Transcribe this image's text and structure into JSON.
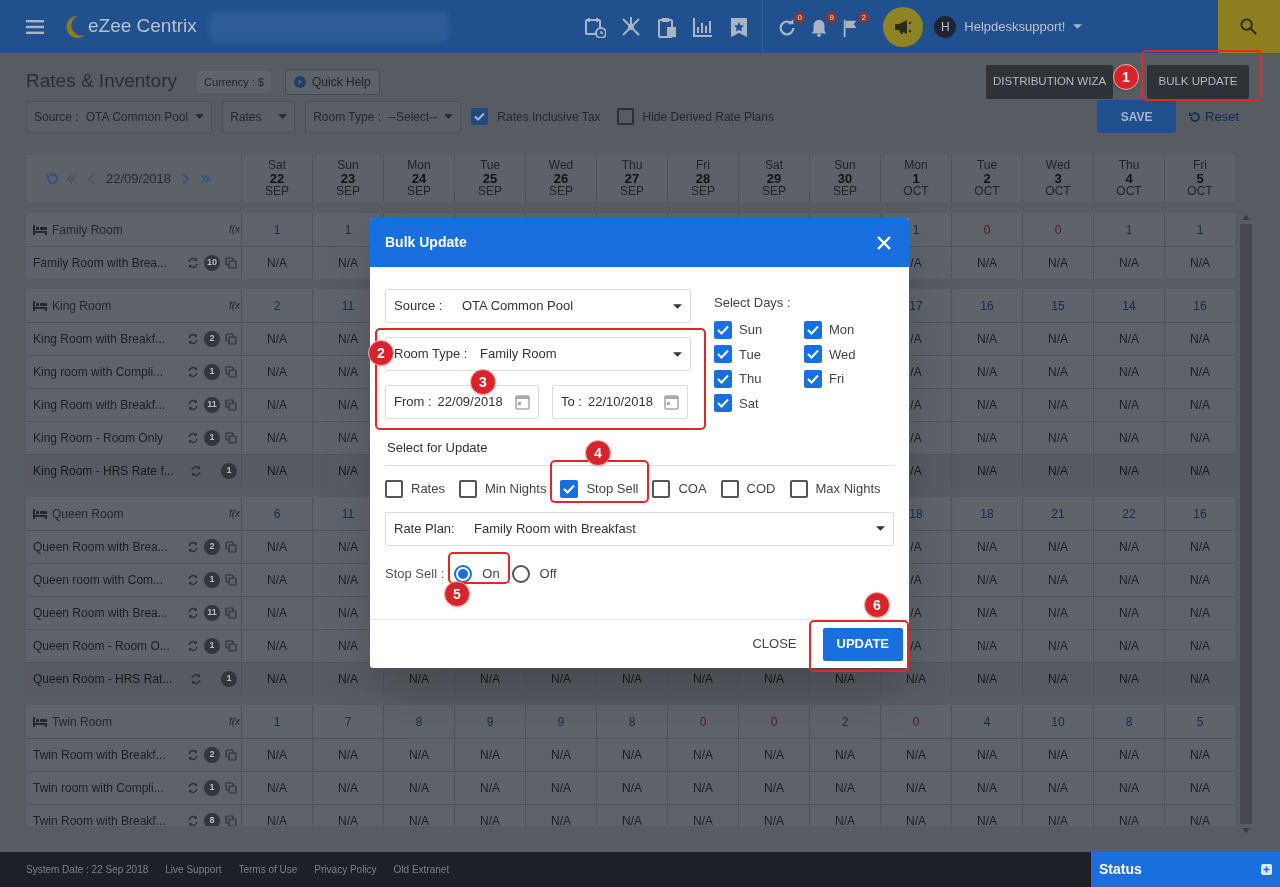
{
  "top_bar": {
    "app_name": "eZee Centrix",
    "notifications": [
      {
        "count": "0"
      },
      {
        "count": "9"
      },
      {
        "count": "2"
      }
    ],
    "user": {
      "initial": "H",
      "name": "Helpdesksupport!"
    }
  },
  "page": {
    "title": "Rates & Inventory",
    "currency": "Currency : $",
    "quick_help": "Quick Help",
    "buttons": [
      "DISTRIBUTION WIZA",
      "BULK UPDATE"
    ]
  },
  "filters": {
    "source": {
      "label": "Source :",
      "value": "OTA Common Pool"
    },
    "rates": {
      "value": "Rates"
    },
    "room_type": {
      "label": "Room Type :",
      "value": "--Select--"
    },
    "checkboxes": [
      {
        "label": "Rates Inclusive Tax",
        "checked": true
      },
      {
        "label": "Hide Derived Rate Plans",
        "checked": false
      }
    ],
    "save": "SAVE",
    "reset": "Reset"
  },
  "grid": {
    "date": "22/09/2018",
    "columns": [
      {
        "day": "Sat",
        "date": "22",
        "month": "SEP"
      },
      {
        "day": "Sun",
        "date": "23",
        "month": "SEP"
      },
      {
        "day": "Mon",
        "date": "24",
        "month": "SEP"
      },
      {
        "day": "Tue",
        "date": "25",
        "month": "SEP"
      },
      {
        "day": "Wed",
        "date": "26",
        "month": "SEP"
      },
      {
        "day": "Thu",
        "date": "27",
        "month": "SEP"
      },
      {
        "day": "Fri",
        "date": "28",
        "month": "SEP"
      },
      {
        "day": "Sat",
        "date": "29",
        "month": "SEP"
      },
      {
        "day": "Sun",
        "date": "30",
        "month": "SEP"
      },
      {
        "day": "Mon",
        "date": "1",
        "month": "OCT"
      },
      {
        "day": "Tue",
        "date": "2",
        "month": "OCT"
      },
      {
        "day": "Wed",
        "date": "3",
        "month": "OCT"
      },
      {
        "day": "Thu",
        "date": "4",
        "month": "OCT"
      },
      {
        "day": "Fri",
        "date": "5",
        "month": "OCT"
      }
    ],
    "groups": [
      {
        "name": "Family Room",
        "formula": "f(x",
        "availability": [
          {
            "value": "1",
            "color": "#142a4d"
          },
          {
            "value": "1",
            "color": "#142a4d"
          },
          {
            "value": "1",
            "color": "#142a4d"
          },
          {
            "value": "0",
            "color": "#5a1414"
          },
          {
            "value": "0",
            "color": "#5a1414"
          },
          {
            "value": "1",
            "color": "#142a4d"
          },
          {
            "value": "1",
            "color": "#142a4d"
          }
        ],
        "rate_plans": [
          {
            "name": "Family Room with Brea...",
            "count": "10",
            "kind": "rate",
            "cells": [
              "N/A",
              "N/A",
              "/A",
              "N/A",
              "N/A",
              "N/A",
              "N/A"
            ]
          }
        ]
      },
      {
        "name": "King Room",
        "formula": "f(x",
        "availability": [
          {
            "value": "2",
            "color": "#142a4d"
          },
          {
            "value": "11",
            "color": "#142a4d"
          },
          {
            "value": "17",
            "color": "#142a4d"
          },
          {
            "value": "16",
            "color": "#142a4d"
          },
          {
            "value": "15",
            "color": "#142a4d"
          },
          {
            "value": "14",
            "color": "#142a4d"
          },
          {
            "value": "16",
            "color": "#142a4d"
          }
        ],
        "rate_plans": [
          {
            "name": "King Room with Breakf...",
            "count": "2",
            "kind": "rate",
            "cells": [
              "N/A",
              "N/A",
              "/A",
              "N/A",
              "N/A",
              "N/A",
              "N/A"
            ]
          },
          {
            "name": "King room with Compli...",
            "count": "1",
            "kind": "rate",
            "cells": [
              "N/A",
              "N/A",
              "/A",
              "N/A",
              "N/A",
              "N/A",
              "N/A"
            ]
          },
          {
            "name": "King Room with Breakf...",
            "count": "11",
            "kind": "rate",
            "cells": [
              "N/A",
              "N/A",
              "/A",
              "N/A",
              "N/A",
              "N/A",
              "N/A"
            ]
          },
          {
            "name": "King Room - Room Only",
            "count": "1",
            "kind": "rate",
            "cells": [
              "N/A",
              "N/A",
              "/A",
              "N/A",
              "N/A",
              "N/A",
              "N/A"
            ]
          },
          {
            "name": "King Room - HRS Rate f...",
            "count": "1",
            "kind": "derived",
            "cells": [
              "N/A",
              "N/A",
              "/A",
              "N/A",
              "N/A",
              "N/A",
              "N/A"
            ]
          }
        ]
      },
      {
        "name": "Queen Room",
        "formula": "f(x",
        "availability": [
          {
            "value": "6",
            "color": "#142a4d"
          },
          {
            "value": "11",
            "color": "#142a4d"
          },
          {
            "value": "18",
            "color": "#142a4d"
          },
          {
            "value": "18",
            "color": "#142a4d"
          },
          {
            "value": "21",
            "color": "#142a4d"
          },
          {
            "value": "22",
            "color": "#142a4d"
          },
          {
            "value": "16",
            "color": "#142a4d"
          }
        ],
        "rate_plans": [
          {
            "name": "Queen Room with Brea...",
            "count": "2",
            "kind": "rate",
            "cells": [
              "N/A",
              "N/A",
              "/A",
              "N/A",
              "N/A",
              "N/A",
              "N/A"
            ]
          },
          {
            "name": "Queen room with Com...",
            "count": "1",
            "kind": "rate",
            "cells": [
              "N/A",
              "N/A",
              "/A",
              "N/A",
              "N/A",
              "N/A",
              "N/A"
            ]
          },
          {
            "name": "Queen Room with Brea...",
            "count": "11",
            "kind": "rate",
            "cells": [
              "N/A",
              "N/A",
              "/A",
              "N/A",
              "N/A",
              "N/A",
              "N/A"
            ]
          },
          {
            "name": "Queen Room - Room O...",
            "count": "1",
            "kind": "rate",
            "cells": [
              "N/A",
              "N/A",
              "/A",
              "N/A",
              "N/A",
              "N/A",
              "N/A"
            ]
          },
          {
            "name": "Queen Room - HRS Rat...",
            "count": "1",
            "kind": "derived",
            "cells": [
              "N/A",
              "N/A",
              "N/A",
              "N/A",
              "N/A",
              "N/A",
              "N/A",
              "N/A",
              "N/A",
              "N/A",
              "N/A",
              "N/A",
              "N/A",
              "N/A"
            ]
          }
        ]
      },
      {
        "name": "Twin Room",
        "formula": "f(x",
        "availability": [
          {
            "value": "1",
            "color": "#142a4d"
          },
          {
            "value": "7",
            "color": "#142a4d"
          },
          {
            "value": "8",
            "color": "#142a4d"
          },
          {
            "value": "9",
            "color": "#142a4d"
          },
          {
            "value": "9",
            "color": "#142a4d"
          },
          {
            "value": "8",
            "color": "#142a4d"
          },
          {
            "value": "0",
            "color": "#5a1414"
          },
          {
            "value": "0",
            "color": "#5a1414"
          },
          {
            "value": "2",
            "color": "#142a4d"
          },
          {
            "value": "0",
            "color": "#5a1414"
          },
          {
            "value": "4",
            "color": "#142a4d"
          },
          {
            "value": "10",
            "color": "#142a4d"
          },
          {
            "value": "8",
            "color": "#142a4d"
          },
          {
            "value": "5",
            "color": "#142a4d"
          }
        ],
        "rate_plans": [
          {
            "name": "Twin Room with Breakf...",
            "count": "2",
            "kind": "rate",
            "cells": [
              "N/A",
              "N/A",
              "N/A",
              "N/A",
              "N/A",
              "N/A",
              "N/A",
              "N/A",
              "N/A",
              "N/A",
              "N/A",
              "N/A",
              "N/A",
              "N/A"
            ]
          },
          {
            "name": "Twin room with Compli...",
            "count": "1",
            "kind": "rate",
            "cells": [
              "N/A",
              "N/A",
              "N/A",
              "N/A",
              "N/A",
              "N/A",
              "N/A",
              "N/A",
              "N/A",
              "N/A",
              "N/A",
              "N/A",
              "N/A",
              "N/A"
            ]
          },
          {
            "name": "Twin Room with Breakf...",
            "count": "8",
            "kind": "rate",
            "cells": [
              "N/A",
              "N/A",
              "N/A",
              "N/A",
              "N/A",
              "N/A",
              "N/A",
              "N/A",
              "N/A",
              "N/A",
              "N/A",
              "N/A",
              "N/A",
              "N/A"
            ]
          }
        ]
      }
    ]
  },
  "bulk_update": {
    "title": "Bulk Update",
    "source": {
      "label": "Source :",
      "value": "OTA Common Pool"
    },
    "room_type": {
      "label": "Room Type :",
      "value": "Family Room"
    },
    "from": {
      "label": "From :",
      "value": "22/09/2018"
    },
    "to": {
      "label": "To :",
      "value": "22/10/2018"
    },
    "select_days": {
      "label": "Select Days :",
      "days": [
        {
          "label": "Sun",
          "checked": true
        },
        {
          "label": "Mon",
          "checked": true
        },
        {
          "label": "Tue",
          "checked": true
        },
        {
          "label": "Wed",
          "checked": true
        },
        {
          "label": "Thu",
          "checked": true
        },
        {
          "label": "Fri",
          "checked": true
        },
        {
          "label": "Sat",
          "checked": true
        }
      ]
    },
    "select_for_update": {
      "label": "Select for Update",
      "options": [
        {
          "label": "Rates",
          "checked": false
        },
        {
          "label": "Min Nights",
          "checked": false
        },
        {
          "label": "Stop Sell",
          "checked": true
        },
        {
          "label": "COA",
          "checked": false
        },
        {
          "label": "COD",
          "checked": false
        },
        {
          "label": "Max Nights",
          "checked": false
        }
      ]
    },
    "rate_plan": {
      "label": "Rate Plan:",
      "value": "Family Room with Breakfast"
    },
    "stop_sell": {
      "label": "Stop Sell :",
      "options": [
        {
          "label": "On",
          "selected": true
        },
        {
          "label": "Off",
          "selected": false
        }
      ]
    },
    "buttons": [
      {
        "label": "CLOSE",
        "kind": "text"
      },
      {
        "label": "UPDATE",
        "kind": "primary"
      }
    ]
  },
  "footer": {
    "links": [
      "System Date : 22 Sep 2018",
      "Live Support",
      "Terms of Use",
      "Privacy Policy",
      "Old Extranet"
    ],
    "status": "Status"
  },
  "annotations": [
    {
      "number": "1"
    },
    {
      "number": "2"
    },
    {
      "number": "3"
    },
    {
      "number": "4"
    },
    {
      "number": "5"
    },
    {
      "number": "6"
    }
  ]
}
